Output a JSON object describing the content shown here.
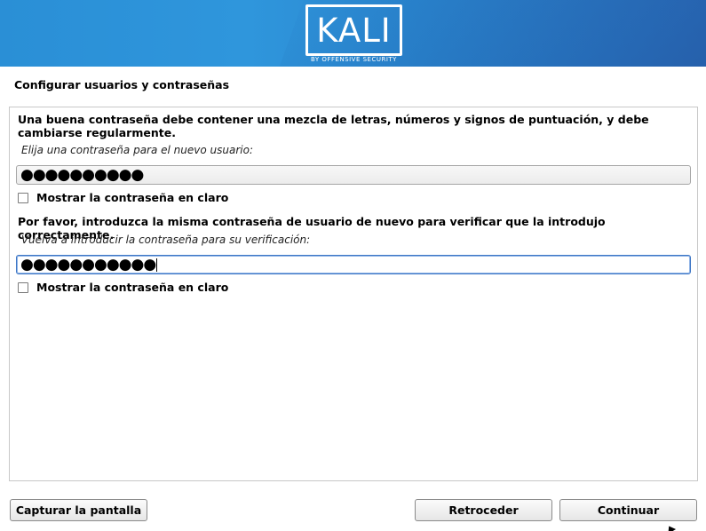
{
  "header": {
    "logo_text": "KALI",
    "logo_subtitle": "BY OFFENSIVE SECURITY"
  },
  "page": {
    "title": "Configurar usuarios y contraseñas"
  },
  "form": {
    "description": "Una buena contraseña debe contener una mezcla de letras, números y signos de puntuación, y debe cambiarse regularmente.",
    "password_prompt": "Elija una contraseña para el nuevo usuario:",
    "password_value": "●●●●●●●●●●",
    "show_password_label": "Mostrar la contraseña en claro",
    "verify_description": "Por favor, introduzca la misma contraseña de usuario de nuevo para verificar que la introdujo correctamente.",
    "verify_prompt": "Vuelva a introducir la contraseña para su verificación:",
    "verify_value": "●●●●●●●●●●●",
    "show_verify_label": "Mostrar la contraseña en claro"
  },
  "buttons": {
    "screenshot": "Capturar la pantalla",
    "back": "Retroceder",
    "continue": "Continuar"
  },
  "colors": {
    "banner": "#2a8fd6",
    "focus": "#3d76c5"
  }
}
